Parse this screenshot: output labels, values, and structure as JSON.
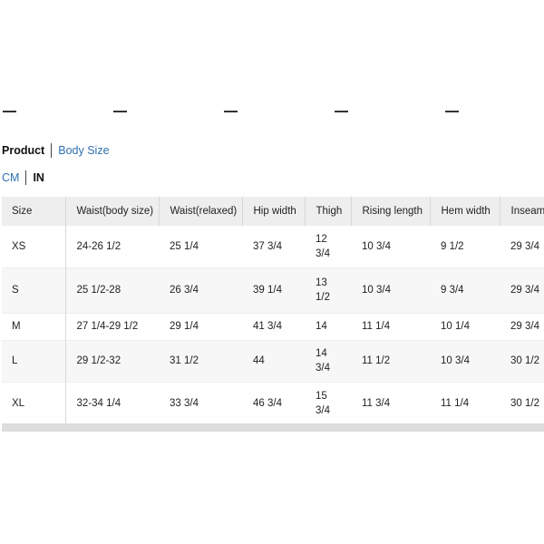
{
  "separator_dashes": [
    "—",
    "—",
    "—",
    "—",
    "—"
  ],
  "tabs": {
    "primary": [
      {
        "label": "Product",
        "active": true
      },
      {
        "label": "Body Size",
        "active": false
      }
    ],
    "units": [
      {
        "label": "CM",
        "active": false
      },
      {
        "label": "IN",
        "active": true
      }
    ]
  },
  "colors": {
    "link": "#2f6fb0",
    "header_bg": "#eeeeee",
    "stripe_bg": "#f7f7f7",
    "footer_bar": "#dddddd"
  },
  "size_table": {
    "headers": [
      "Size",
      "Waist(body size)",
      "Waist(relaxed)",
      "Hip width",
      "Thigh",
      "Rising length",
      "Hem width",
      "Inseam"
    ],
    "rows": [
      [
        "XS",
        "24-26 1/2",
        "25 1/4",
        "37 3/4",
        "12 3/4",
        "10 3/4",
        "9 1/2",
        "29 3/4"
      ],
      [
        "S",
        "25 1/2-28",
        "26 3/4",
        "39 1/4",
        "13 1/2",
        "10 3/4",
        "9 3/4",
        "29 3/4"
      ],
      [
        "M",
        "27 1/4-29 1/2",
        "29 1/4",
        "41 3/4",
        "14",
        "11 1/4",
        "10 1/4",
        "29 3/4"
      ],
      [
        "L",
        "29 1/2-32",
        "31 1/2",
        "44",
        "14 3/4",
        "11 1/2",
        "10 3/4",
        "30 1/2"
      ],
      [
        "XL",
        "32-34 1/4",
        "33 3/4",
        "46 3/4",
        "15 3/4",
        "11 3/4",
        "11 1/4",
        "30 1/2"
      ]
    ]
  }
}
